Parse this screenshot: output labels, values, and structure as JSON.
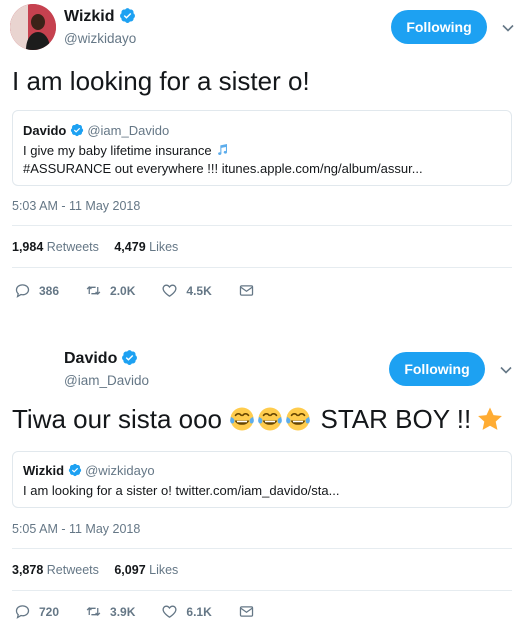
{
  "tweet1": {
    "name": "Wizkid",
    "handle": "@wizkidayo",
    "follow_label": "Following",
    "text": "I am looking for a sister o!",
    "quote": {
      "name": "Davido",
      "handle": "@iam_Davido",
      "line1": "I give my baby lifetime insurance",
      "line2": "#ASSURANCE out everywhere !!! itunes.apple.com/ng/album/assur..."
    },
    "time": "5:03 AM - 11 May 2018",
    "retweets_count": "1,984",
    "retweets_label": "Retweets",
    "likes_count": "4,479",
    "likes_label": "Likes",
    "actions": {
      "replies": "386",
      "retweets": "2.0K",
      "likes": "4.5K"
    }
  },
  "tweet2": {
    "name": "Davido",
    "handle": "@iam_Davido",
    "follow_label": "Following",
    "text_before": "Tiwa our sista ooo",
    "text_after": "STAR BOY !!",
    "quote": {
      "name": "Wizkid",
      "handle": "@wizkidayo",
      "line1": "I am looking for a sister o! twitter.com/iam_davido/sta..."
    },
    "time": "5:05 AM - 11 May 2018",
    "retweets_count": "3,878",
    "retweets_label": "Retweets",
    "likes_count": "6,097",
    "likes_label": "Likes",
    "actions": {
      "replies": "720",
      "retweets": "3.9K",
      "likes": "6.1K"
    }
  },
  "colors": {
    "accent": "#1da1f2",
    "muted": "#657786",
    "border": "#e1e8ed"
  },
  "icons": [
    "verified-icon",
    "chevron-down-icon",
    "reply-icon",
    "retweet-icon",
    "like-icon",
    "message-icon",
    "music-notes-icon",
    "tears-of-joy-emoji",
    "star-emoji"
  ]
}
